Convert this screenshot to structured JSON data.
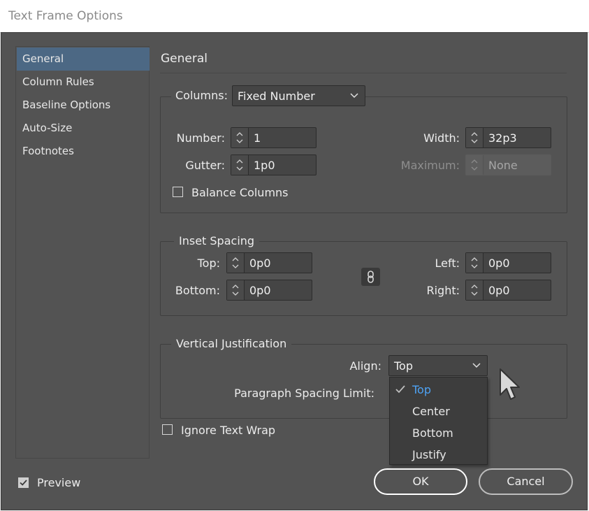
{
  "window": {
    "title": "Text Frame Options"
  },
  "sidebar": {
    "items": [
      {
        "label": "General"
      },
      {
        "label": "Column Rules"
      },
      {
        "label": "Baseline Options"
      },
      {
        "label": "Auto-Size"
      },
      {
        "label": "Footnotes"
      }
    ],
    "selected": "General"
  },
  "main": {
    "heading": "General"
  },
  "columns": {
    "label": "Columns:",
    "mode": "Fixed Number",
    "number_label": "Number:",
    "number": "1",
    "width_label": "Width:",
    "width": "32p3",
    "gutter_label": "Gutter:",
    "gutter": "1p0",
    "maximum_label": "Maximum:",
    "maximum": "None",
    "balance_label": "Balance Columns",
    "balance_checked": false
  },
  "inset": {
    "title": "Inset Spacing",
    "top_label": "Top:",
    "top": "0p0",
    "bottom_label": "Bottom:",
    "bottom": "0p0",
    "left_label": "Left:",
    "left": "0p0",
    "right_label": "Right:",
    "right": "0p0",
    "link_icon": "chain-link-icon"
  },
  "vertical": {
    "title": "Vertical Justification",
    "align_label": "Align:",
    "align": "Top",
    "spacing_label": "Paragraph Spacing Limit:",
    "options": [
      {
        "label": "Top",
        "selected": true
      },
      {
        "label": "Center"
      },
      {
        "label": "Bottom"
      },
      {
        "label": "Justify"
      }
    ]
  },
  "ignore_wrap": {
    "label": "Ignore Text Wrap",
    "checked": false
  },
  "preview": {
    "label": "Preview",
    "checked": true
  },
  "buttons": {
    "ok": "OK",
    "cancel": "Cancel"
  },
  "colors": {
    "panel": "#535353",
    "selection": "#4c6884",
    "menu_selected": "#4ea3f5"
  }
}
